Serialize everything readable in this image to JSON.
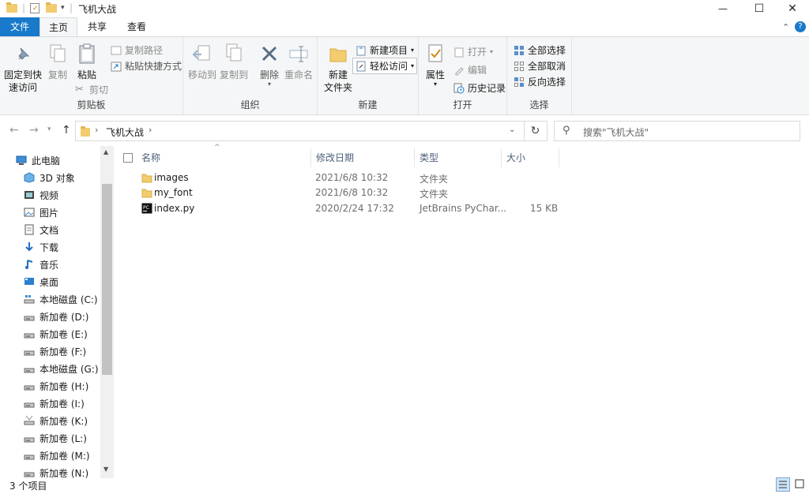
{
  "window": {
    "title": "飞机大战",
    "controls": {
      "minimize": "—",
      "maximize": "☐",
      "close": "✕"
    }
  },
  "ribbon_tabs": {
    "file": "文件",
    "home": "主页",
    "share": "共享",
    "view": "查看"
  },
  "ribbon": {
    "clipboard": {
      "label": "剪贴板",
      "pin_quick_access_line1": "固定到快",
      "pin_quick_access_line2": "速访问",
      "copy": "复制",
      "paste": "粘贴",
      "copy_path": "复制路径",
      "paste_shortcut": "粘贴快捷方式",
      "cut": "剪切"
    },
    "organize": {
      "label": "组织",
      "move_to": "移动到",
      "copy_to": "复制到",
      "delete": "删除",
      "rename": "重命名"
    },
    "new": {
      "label": "新建",
      "new_folder_line1": "新建",
      "new_folder_line2": "文件夹",
      "new_item": "新建项目",
      "easy_access": "轻松访问"
    },
    "open": {
      "label": "打开",
      "properties": "属性",
      "open": "打开",
      "edit": "编辑",
      "history": "历史记录"
    },
    "select": {
      "label": "选择",
      "select_all": "全部选择",
      "select_none": "全部取消",
      "invert": "反向选择"
    }
  },
  "address": {
    "path": "飞机大战",
    "search_placeholder": "搜索\"飞机大战\""
  },
  "nav": [
    {
      "label": "此电脑",
      "icon": "computer-icon"
    },
    {
      "label": "3D 对象",
      "icon": "cube-icon"
    },
    {
      "label": "视频",
      "icon": "video-icon"
    },
    {
      "label": "图片",
      "icon": "picture-icon"
    },
    {
      "label": "文档",
      "icon": "document-icon"
    },
    {
      "label": "下载",
      "icon": "download-icon"
    },
    {
      "label": "音乐",
      "icon": "music-icon"
    },
    {
      "label": "桌面",
      "icon": "desktop-icon"
    },
    {
      "label": "本地磁盘 (C:)",
      "icon": "system-drive-icon"
    },
    {
      "label": "新加卷 (D:)",
      "icon": "drive-icon"
    },
    {
      "label": "新加卷 (E:)",
      "icon": "drive-icon"
    },
    {
      "label": "新加卷 (F:)",
      "icon": "drive-icon"
    },
    {
      "label": "本地磁盘 (G:)",
      "icon": "drive-icon"
    },
    {
      "label": "新加卷 (H:)",
      "icon": "drive-icon"
    },
    {
      "label": "新加卷 (I:)",
      "icon": "drive-icon"
    },
    {
      "label": "新加卷 (K:)",
      "icon": "drive-warning-icon"
    },
    {
      "label": "新加卷 (L:)",
      "icon": "drive-icon"
    },
    {
      "label": "新加卷 (M:)",
      "icon": "drive-icon"
    },
    {
      "label": "新加卷 (N:)",
      "icon": "drive-icon"
    }
  ],
  "columns": {
    "name": "名称",
    "modified": "修改日期",
    "type": "类型",
    "size": "大小"
  },
  "files": [
    {
      "name": "images",
      "modified": "2021/6/8 10:32",
      "type": "文件夹",
      "size": "",
      "icon": "folder-icon"
    },
    {
      "name": "my_font",
      "modified": "2021/6/8 10:32",
      "type": "文件夹",
      "size": "",
      "icon": "folder-icon"
    },
    {
      "name": "index.py",
      "modified": "2020/2/24 17:32",
      "type": "JetBrains PyChar...",
      "size": "15 KB",
      "icon": "pycharm-file-icon"
    }
  ],
  "status": {
    "count": "3 个项目"
  },
  "colors": {
    "accent": "#1979ca",
    "folder": "#f2cc6e",
    "ribbon_bg": "#f5f6f7"
  }
}
